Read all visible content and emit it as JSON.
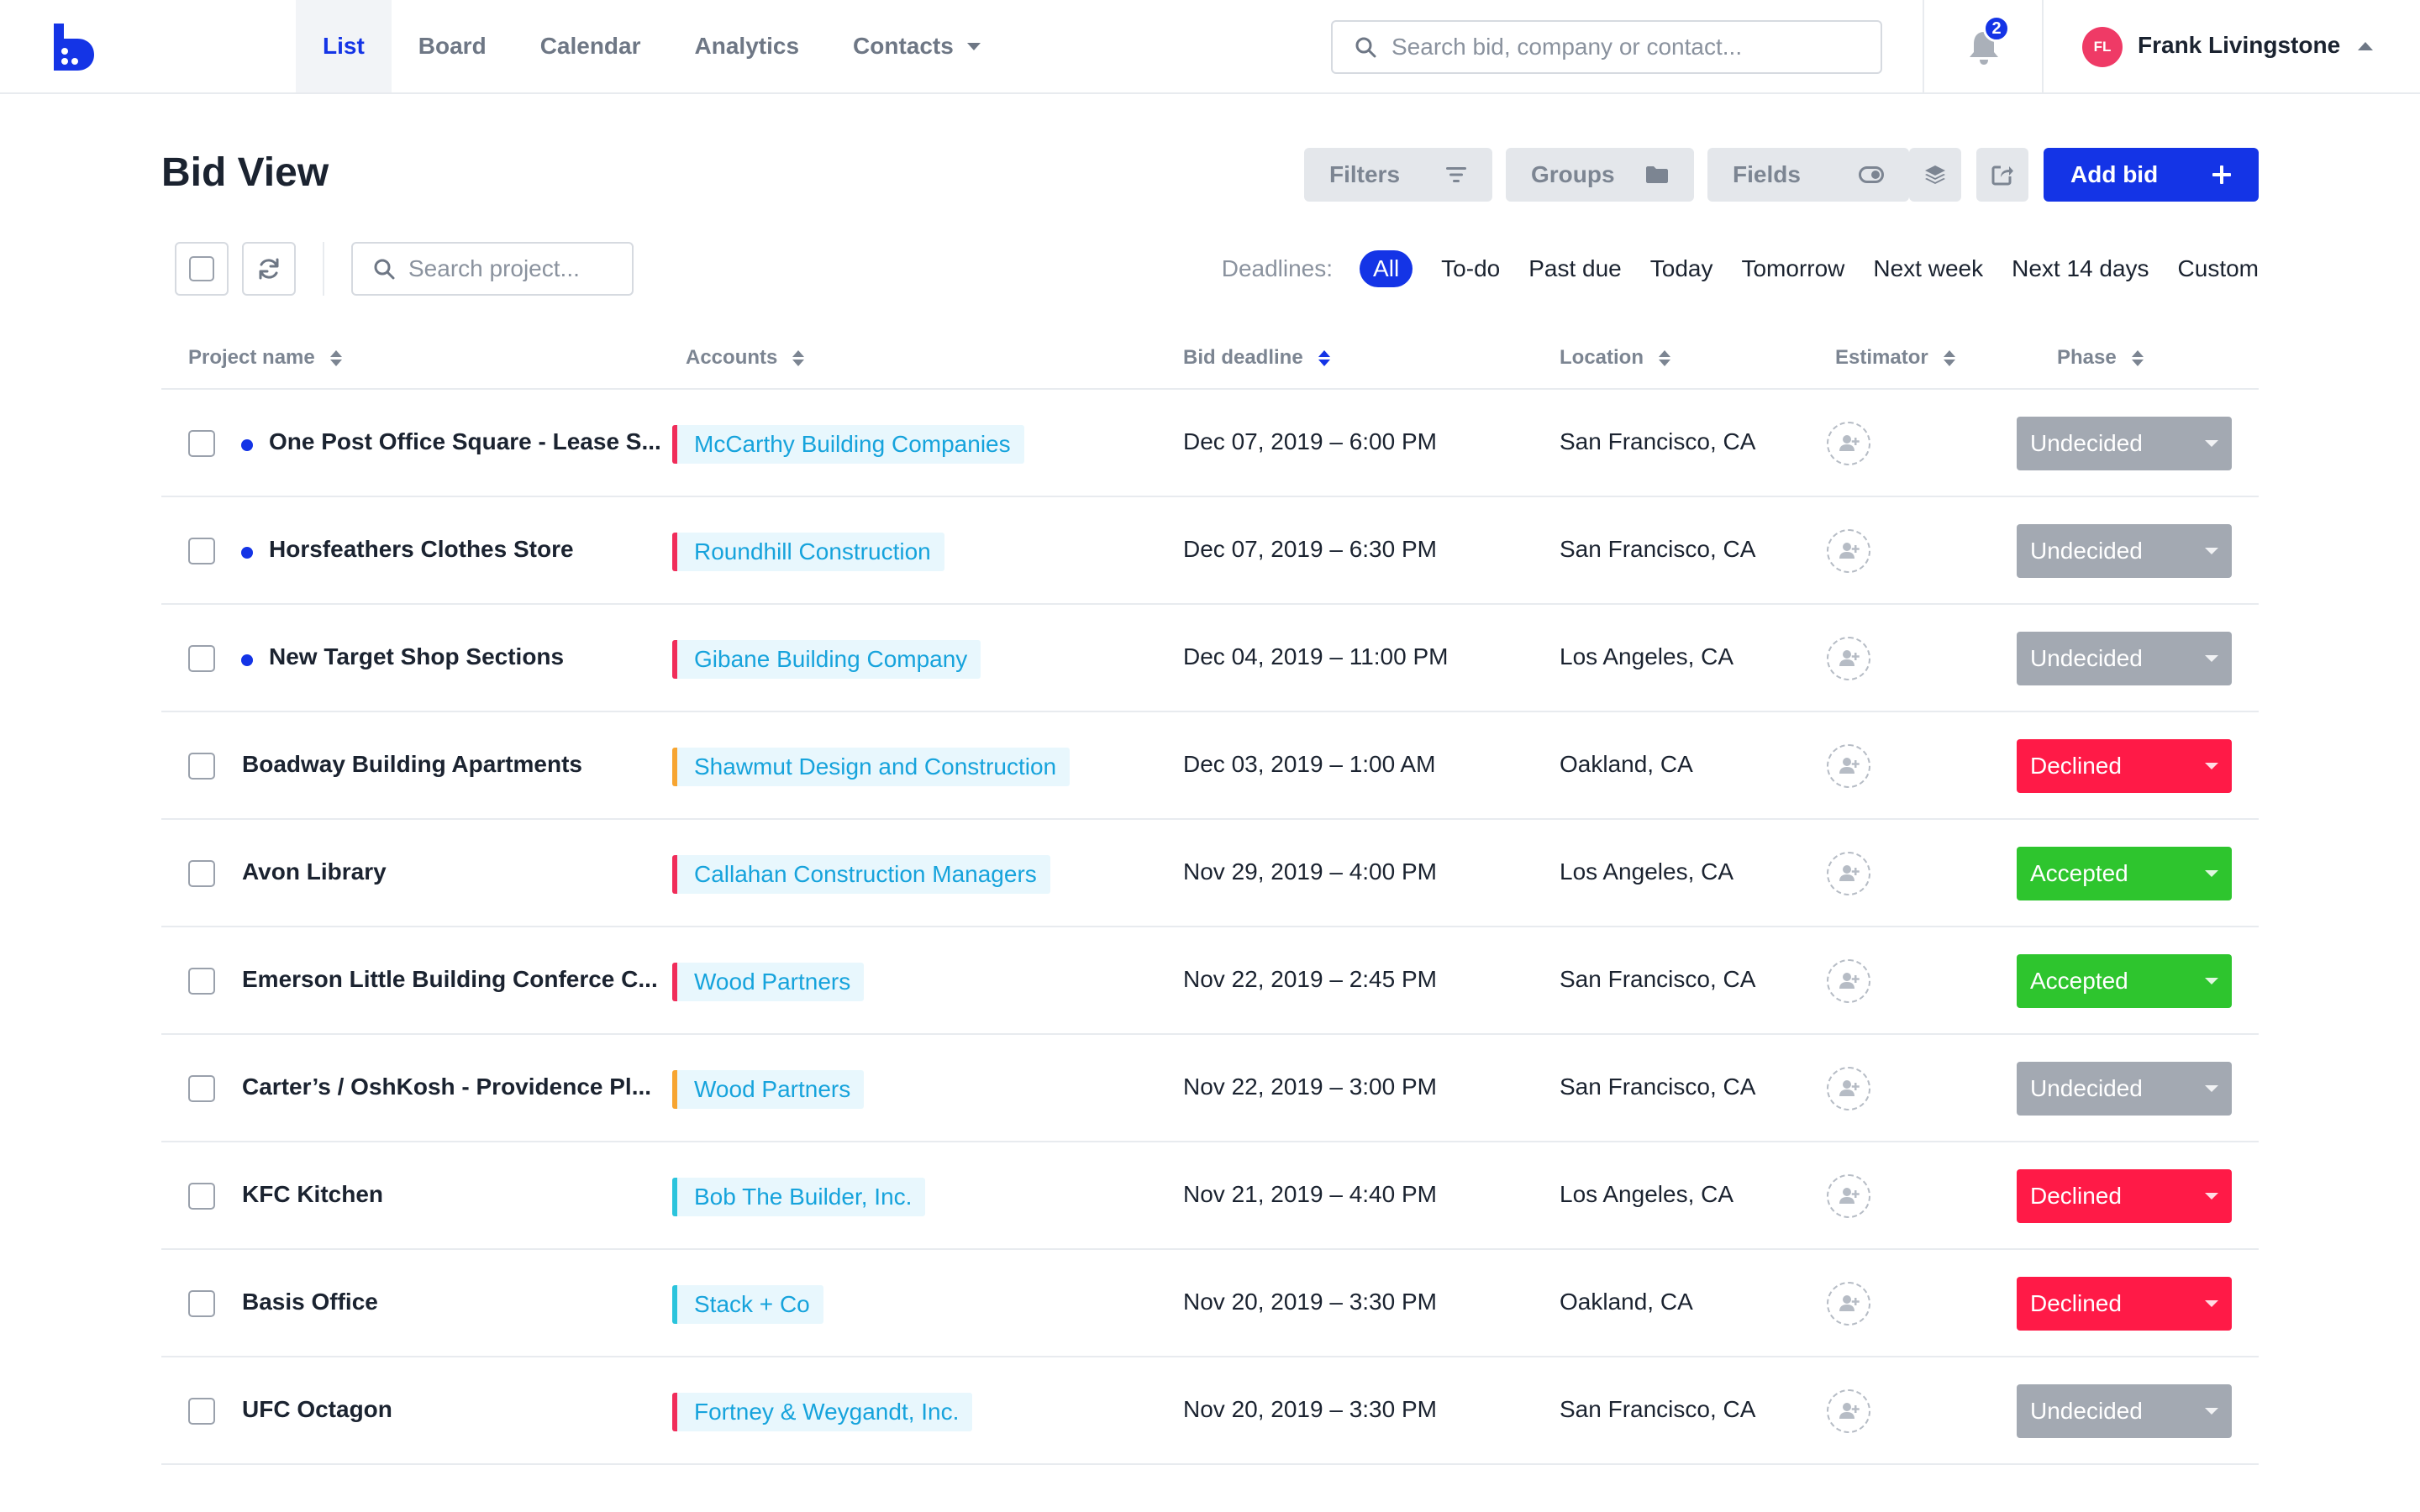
{
  "nav": {
    "tabs": [
      {
        "label": "List",
        "active": true
      },
      {
        "label": "Board"
      },
      {
        "label": "Calendar"
      },
      {
        "label": "Analytics"
      },
      {
        "label": "Contacts",
        "dropdown": true
      }
    ],
    "search_placeholder": "Search bid, company or contact...",
    "notification_count": "2",
    "user": {
      "initials": "FL",
      "name": "Frank Livingstone"
    }
  },
  "header": {
    "title": "Bid View",
    "filters_label": "Filters",
    "groups_label": "Groups",
    "fields_label": "Fields",
    "add_label": "Add bid"
  },
  "toolbar": {
    "project_search_placeholder": "Search project...",
    "deadlines_label": "Deadlines:",
    "deadline_options": [
      "All",
      "To-do",
      "Past due",
      "Today",
      "Tomorrow",
      "Next week",
      "Next 14 days",
      "Custom"
    ],
    "active_deadline": "All"
  },
  "table": {
    "columns": [
      "Project name",
      "Accounts",
      "Bid deadline",
      "Location",
      "Estimator",
      "Phase"
    ],
    "sorted_column": "Bid deadline",
    "rows": [
      {
        "name": "One Post Office Square - Lease S...",
        "unread": true,
        "account": "McCarthy Building Companies",
        "account_color": "#f02d5a",
        "deadline": "Dec 07, 2019 – 6:00 PM",
        "location": "San Francisco, CA",
        "phase": "Undecided"
      },
      {
        "name": "Horsfeathers Clothes Store",
        "unread": true,
        "account": "Roundhill Construction",
        "account_color": "#f02d5a",
        "deadline": "Dec 07, 2019 – 6:30 PM",
        "location": "San Francisco, CA",
        "phase": "Undecided"
      },
      {
        "name": "New Target Shop Sections",
        "unread": true,
        "account": "Gibane Building Company",
        "account_color": "#f02d5a",
        "deadline": "Dec 04, 2019 – 11:00 PM",
        "location": "Los Angeles, CA",
        "phase": "Undecided"
      },
      {
        "name": "Boadway Building Apartments",
        "unread": false,
        "account": "Shawmut Design and Construction",
        "account_color": "#f7a531",
        "deadline": "Dec 03, 2019 – 1:00 AM",
        "location": "Oakland, CA",
        "phase": "Declined"
      },
      {
        "name": "Avon Library",
        "unread": false,
        "account": "Callahan Construction Managers",
        "account_color": "#f02d5a",
        "deadline": "Nov 29, 2019 – 4:00 PM",
        "location": "Los Angeles, CA",
        "phase": "Accepted"
      },
      {
        "name": "Emerson Little Building Conferce C...",
        "unread": false,
        "account": "Wood Partners",
        "account_color": "#f02d5a",
        "deadline": "Nov 22, 2019 – 2:45 PM",
        "location": "San Francisco, CA",
        "phase": "Accepted"
      },
      {
        "name": "Carter’s / OshKosh - Providence Pl...",
        "unread": false,
        "account": "Wood Partners",
        "account_color": "#f7a531",
        "deadline": "Nov 22, 2019 – 3:00 PM",
        "location": "San Francisco, CA",
        "phase": "Undecided"
      },
      {
        "name": "KFC Kitchen",
        "unread": false,
        "account": "Bob The Builder, Inc.",
        "account_color": "#2bc4dc",
        "deadline": "Nov 21, 2019 – 4:40 PM",
        "location": "Los Angeles, CA",
        "phase": "Declined"
      },
      {
        "name": "Basis Office",
        "unread": false,
        "account": "Stack + Co",
        "account_color": "#2bc4dc",
        "deadline": "Nov 20, 2019 – 3:30 PM",
        "location": "Oakland, CA",
        "phase": "Declined"
      },
      {
        "name": "UFC Octagon",
        "unread": false,
        "account": "Fortney & Weygandt, Inc.",
        "account_color": "#f02d5a",
        "deadline": "Nov 20, 2019 – 3:30 PM",
        "location": "San Francisco, CA",
        "phase": "Undecided"
      }
    ]
  },
  "colors": {
    "accent": "#1434e6",
    "phase_undecided": "#a3a9b2",
    "phase_declined": "#ff1a47",
    "phase_accepted": "#2ec52e"
  }
}
